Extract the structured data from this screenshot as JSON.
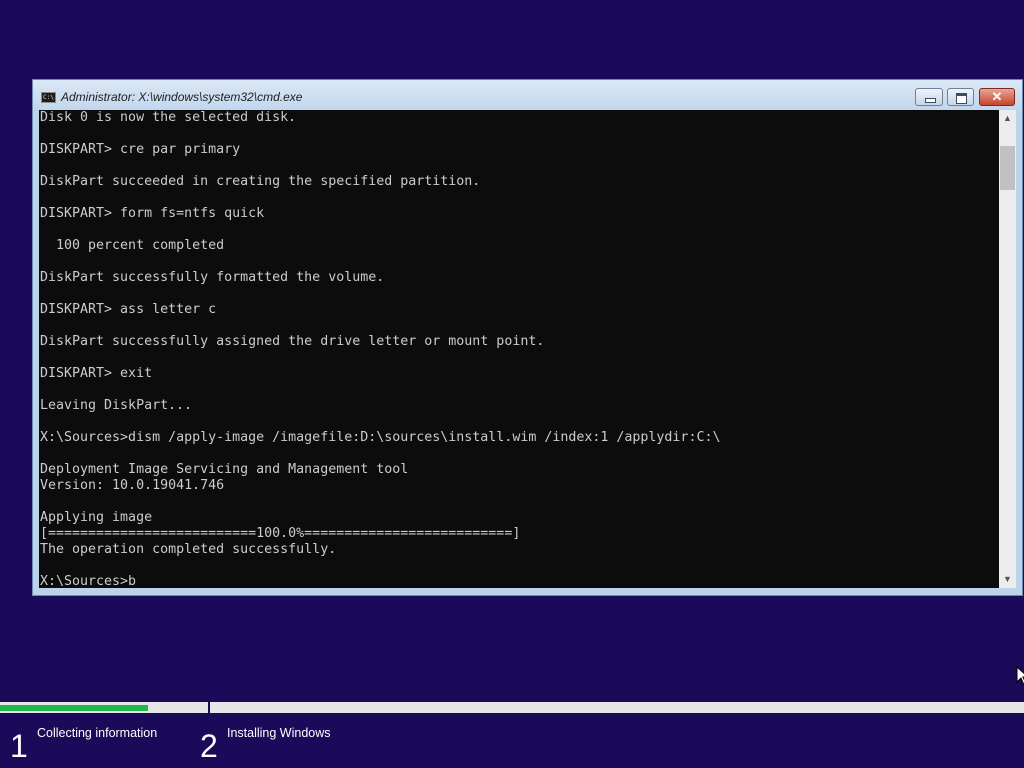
{
  "window": {
    "title": "Administrator: X:\\windows\\system32\\cmd.exe",
    "title_icon": "cmd-icon",
    "title_icon_text": "C:\\",
    "buttons": {
      "minimize": "minimize-icon",
      "maximize": "maximize-icon",
      "close": "close-icon"
    }
  },
  "console": {
    "lines": [
      "Disk 0 is now the selected disk.",
      "",
      "DISKPART> cre par primary",
      "",
      "DiskPart succeeded in creating the specified partition.",
      "",
      "DISKPART> form fs=ntfs quick",
      "",
      "  100 percent completed",
      "",
      "DiskPart successfully formatted the volume.",
      "",
      "DISKPART> ass letter c",
      "",
      "DiskPart successfully assigned the drive letter or mount point.",
      "",
      "DISKPART> exit",
      "",
      "Leaving DiskPart...",
      "",
      "X:\\Sources>dism /apply-image /imagefile:D:\\sources\\install.wim /index:1 /applydir:C:\\",
      "",
      "Deployment Image Servicing and Management tool",
      "Version: 10.0.19041.746",
      "",
      "Applying image",
      "[==========================100.0%==========================]",
      "The operation completed successfully.",
      "",
      "X:\\Sources>b"
    ]
  },
  "scrollbar": {
    "up_arrow": "▲",
    "down_arrow": "▼"
  },
  "setup": {
    "progress": 0.145,
    "steps": [
      {
        "number": "1",
        "label": "Collecting information"
      },
      {
        "number": "2",
        "label": "Installing Windows"
      }
    ]
  },
  "colors": {
    "desktop_background": "#1b0a59",
    "console_background": "#0c0c0c",
    "console_text": "#cccccc",
    "progress_fill": "#1fb84b"
  }
}
